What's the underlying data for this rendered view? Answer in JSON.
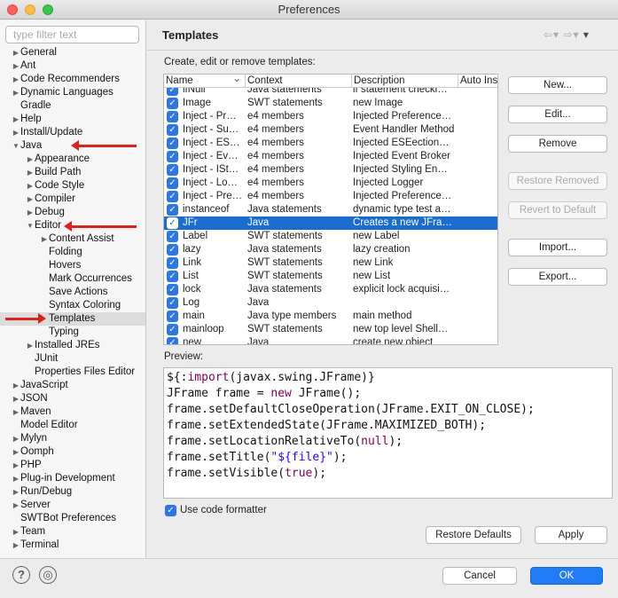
{
  "window": {
    "title": "Preferences"
  },
  "filter": {
    "placeholder": "type filter text"
  },
  "tree": [
    {
      "label": "General",
      "twisty": "▶"
    },
    {
      "label": "Ant",
      "twisty": "▶"
    },
    {
      "label": "Code Recommenders",
      "twisty": "▶"
    },
    {
      "label": "Dynamic Languages",
      "twisty": "▶"
    },
    {
      "label": "Gradle",
      "twisty": ""
    },
    {
      "label": "Help",
      "twisty": "▶"
    },
    {
      "label": "Install/Update",
      "twisty": "▶"
    },
    {
      "label": "Java",
      "twisty": "▼"
    },
    {
      "label": "Appearance",
      "twisty": "▶"
    },
    {
      "label": "Build Path",
      "twisty": "▶"
    },
    {
      "label": "Code Style",
      "twisty": "▶"
    },
    {
      "label": "Compiler",
      "twisty": "▶"
    },
    {
      "label": "Debug",
      "twisty": "▶"
    },
    {
      "label": "Editor",
      "twisty": "▼"
    },
    {
      "label": "Content Assist",
      "twisty": "▶"
    },
    {
      "label": "Folding",
      "twisty": ""
    },
    {
      "label": "Hovers",
      "twisty": ""
    },
    {
      "label": "Mark Occurrences",
      "twisty": ""
    },
    {
      "label": "Save Actions",
      "twisty": ""
    },
    {
      "label": "Syntax Coloring",
      "twisty": ""
    },
    {
      "label": "Templates",
      "twisty": ""
    },
    {
      "label": "Typing",
      "twisty": ""
    },
    {
      "label": "Installed JREs",
      "twisty": "▶"
    },
    {
      "label": "JUnit",
      "twisty": ""
    },
    {
      "label": "Properties Files Editor",
      "twisty": ""
    },
    {
      "label": "JavaScript",
      "twisty": "▶"
    },
    {
      "label": "JSON",
      "twisty": "▶"
    },
    {
      "label": "Maven",
      "twisty": "▶"
    },
    {
      "label": "Model Editor",
      "twisty": ""
    },
    {
      "label": "Mylyn",
      "twisty": "▶"
    },
    {
      "label": "Oomph",
      "twisty": "▶"
    },
    {
      "label": "PHP",
      "twisty": "▶"
    },
    {
      "label": "Plug-in Development",
      "twisty": "▶"
    },
    {
      "label": "Run/Debug",
      "twisty": "▶"
    },
    {
      "label": "Server",
      "twisty": "▶"
    },
    {
      "label": "SWTBot Preferences",
      "twisty": ""
    },
    {
      "label": "Team",
      "twisty": "▶"
    },
    {
      "label": "Terminal",
      "twisty": "▶"
    }
  ],
  "page": {
    "title": "Templates",
    "nav_back": "⇦▾",
    "nav_forward": "⇨▾",
    "menu": "▾",
    "subtitle": "Create, edit or remove templates:",
    "preview_label": "Preview:",
    "use_formatter_label": "Use code formatter"
  },
  "table": {
    "headers": [
      "Name",
      "Context",
      "Description",
      "Auto Ins"
    ],
    "sort_indicator": "⌄",
    "rows": [
      {
        "name": "ifNull",
        "context": "Java statements",
        "desc": "if statement checki…"
      },
      {
        "name": "Image",
        "context": "SWT statements",
        "desc": "new Image"
      },
      {
        "name": "Inject - Pr…",
        "context": "e4 members",
        "desc": "Injected Preference…"
      },
      {
        "name": "Inject - Su…",
        "context": "e4 members",
        "desc": "Event Handler Method"
      },
      {
        "name": "Inject - ES…",
        "context": "e4 members",
        "desc": "Injected ESEection…"
      },
      {
        "name": "Inject - Ev…",
        "context": "e4 members",
        "desc": "Injected Event Broker"
      },
      {
        "name": "Inject - ISt…",
        "context": "e4 members",
        "desc": "Injected Styling En…"
      },
      {
        "name": "Inject - Lo…",
        "context": "e4 members",
        "desc": "Injected Logger"
      },
      {
        "name": "Inject - Pre…",
        "context": "e4 members",
        "desc": "Injected Preference…"
      },
      {
        "name": "instanceof",
        "context": "Java statements",
        "desc": "dynamic type test a…"
      },
      {
        "name": "JFr",
        "context": "Java",
        "desc": "Creates a new JFra…"
      },
      {
        "name": "Label",
        "context": "SWT statements",
        "desc": "new Label"
      },
      {
        "name": "lazy",
        "context": "Java statements",
        "desc": "lazy creation"
      },
      {
        "name": "Link",
        "context": "SWT statements",
        "desc": "new Link"
      },
      {
        "name": "List",
        "context": "SWT statements",
        "desc": "new List"
      },
      {
        "name": "lock",
        "context": "Java statements",
        "desc": "explicit lock acquisi…"
      },
      {
        "name": "Log",
        "context": "Java",
        "desc": ""
      },
      {
        "name": "main",
        "context": "Java type members",
        "desc": "main method"
      },
      {
        "name": "mainloop",
        "context": "SWT statements",
        "desc": "new top level Shell…"
      },
      {
        "name": "new",
        "context": "Java",
        "desc": "create new object"
      }
    ]
  },
  "buttons": {
    "new": "New...",
    "edit": "Edit...",
    "remove": "Remove",
    "restore_removed": "Restore Removed",
    "revert_default": "Revert to Default",
    "import": "Import...",
    "export": "Export...",
    "restore_defaults": "Restore Defaults",
    "apply": "Apply",
    "cancel": "Cancel",
    "ok": "OK",
    "help": "?",
    "prefs": "◎"
  },
  "preview": {
    "lines": [
      [
        "${:",
        "import",
        "(javax.swing.JFrame)}"
      ],
      [
        "JFrame frame = ",
        "new",
        " JFrame();"
      ],
      [
        "frame.setDefaultCloseOperation(JFrame.EXIT_ON_CLOSE);",
        "",
        ""
      ],
      [
        "frame.setExtendedState(JFrame.MAXIMIZED_BOTH);",
        "",
        ""
      ],
      [
        "frame.setLocationRelativeTo(",
        "null",
        ");"
      ],
      [
        "frame.setTitle(",
        "\"${file}\"",
        ");"
      ],
      [
        "frame.setVisible(",
        "true",
        ");"
      ]
    ]
  },
  "colors": {
    "accent": "#1a6dd0",
    "keyword": "#7f0055",
    "string": "#2a00ff",
    "arrow": "#e0211b"
  }
}
